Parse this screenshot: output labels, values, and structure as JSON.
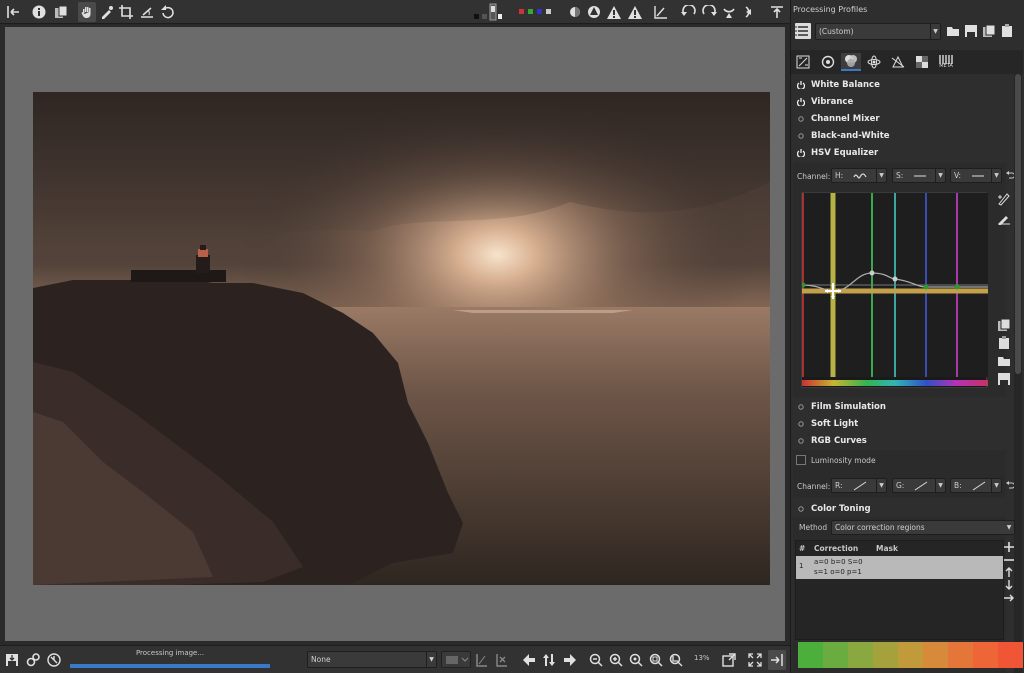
{
  "toolbar": {
    "icons": [
      "sidebar-toggle-icon",
      "info-icon",
      "compare-icon",
      "hand-icon",
      "picker-icon",
      "crop-icon",
      "straighten-icon",
      "clip-indicator-icon",
      "background-color-icon",
      "channel-r-icon",
      "channel-g-icon",
      "channel-b-icon",
      "focus-mask-icon",
      "softproof-icon",
      "warning-icon",
      "warning-icon",
      "histogram-icon",
      "rotate-left-icon",
      "rotate-right-icon",
      "flip-h-icon",
      "flip-v-icon",
      "toggle-right-panel-icon"
    ]
  },
  "viewer": {
    "status_text": "Processing image...",
    "progress": 1.0,
    "profile_select": "None",
    "zoom": "13%"
  },
  "right_panel": {
    "title": "Processing Profiles",
    "profile": "(Custom)",
    "tabs": [
      "exposure-tab",
      "detail-tab",
      "color-tab",
      "advanced-tab",
      "transform-tab",
      "raw-tab",
      "metadata-tab"
    ],
    "tab_meta_label": "META",
    "tools_top": [
      {
        "label": "White Balance",
        "enabled": true
      },
      {
        "label": "Vibrance",
        "enabled": true
      },
      {
        "label": "Channel Mixer",
        "enabled": false
      },
      {
        "label": "Black-and-White",
        "enabled": false
      },
      {
        "label": "HSV Equalizer",
        "enabled": true
      }
    ],
    "hsv": {
      "channel_label": "Channel:",
      "h_label": "H:",
      "s_label": "S:",
      "v_label": "V:"
    },
    "tools_mid": [
      {
        "label": "Film Simulation",
        "enabled": false
      },
      {
        "label": "Soft Light",
        "enabled": false
      },
      {
        "label": "RGB Curves",
        "enabled": false
      }
    ],
    "rgb": {
      "luminosity_label": "Luminosity mode",
      "channel_label": "Channel:",
      "r_label": "R:",
      "g_label": "G:",
      "b_label": "B:"
    },
    "color_toning": {
      "label": "Color Toning",
      "method_label": "Method",
      "method_value": "Color correction regions",
      "col_num": "#",
      "col_correction": "Correction",
      "col_mask": "Mask",
      "row_num": "1",
      "row_line1": "a=0 b=0 S=0",
      "row_line2": "s=1 o=0 p=1"
    },
    "swatch_colors": [
      "#4caf3c",
      "#6aac40",
      "#8aa840",
      "#a5a23e",
      "#c19a3c",
      "#d68a3a",
      "#e4763a",
      "#ee6638",
      "#f05535"
    ]
  }
}
